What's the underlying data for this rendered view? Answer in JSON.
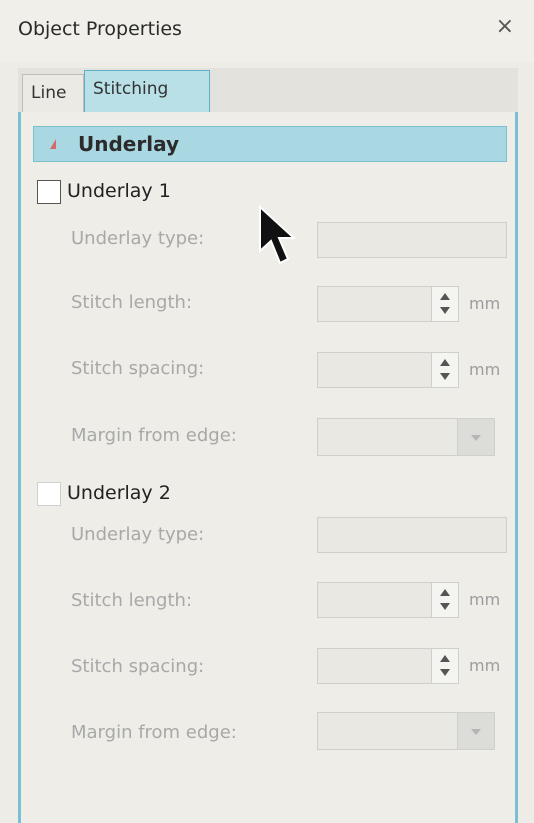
{
  "window": {
    "title": "Object Properties",
    "close_glyph": "×"
  },
  "tabs": [
    {
      "label": "Line",
      "active": false
    },
    {
      "label": "Stitching",
      "active": true
    }
  ],
  "section": {
    "label": "Underlay",
    "expanded": true
  },
  "underlay1": {
    "label": "Underlay 1",
    "checked": false,
    "underlay_type_label": "Underlay type:",
    "stitch_length_label": "Stitch length:",
    "stitch_spacing_label": "Stitch spacing:",
    "margin_label": "Margin from edge:",
    "unit": "mm"
  },
  "underlay2": {
    "label": "Underlay 2",
    "checked": false,
    "underlay_type_label": "Underlay type:",
    "stitch_length_label": "Stitch length:",
    "stitch_spacing_label": "Stitch spacing:",
    "margin_label": "Margin from edge:",
    "unit": "mm"
  },
  "colors": {
    "accent": "#a9d7e2",
    "accent_border": "#79c1d2",
    "disabled_text": "#a8a8a8",
    "expand_triangle": "#d46a6a"
  }
}
